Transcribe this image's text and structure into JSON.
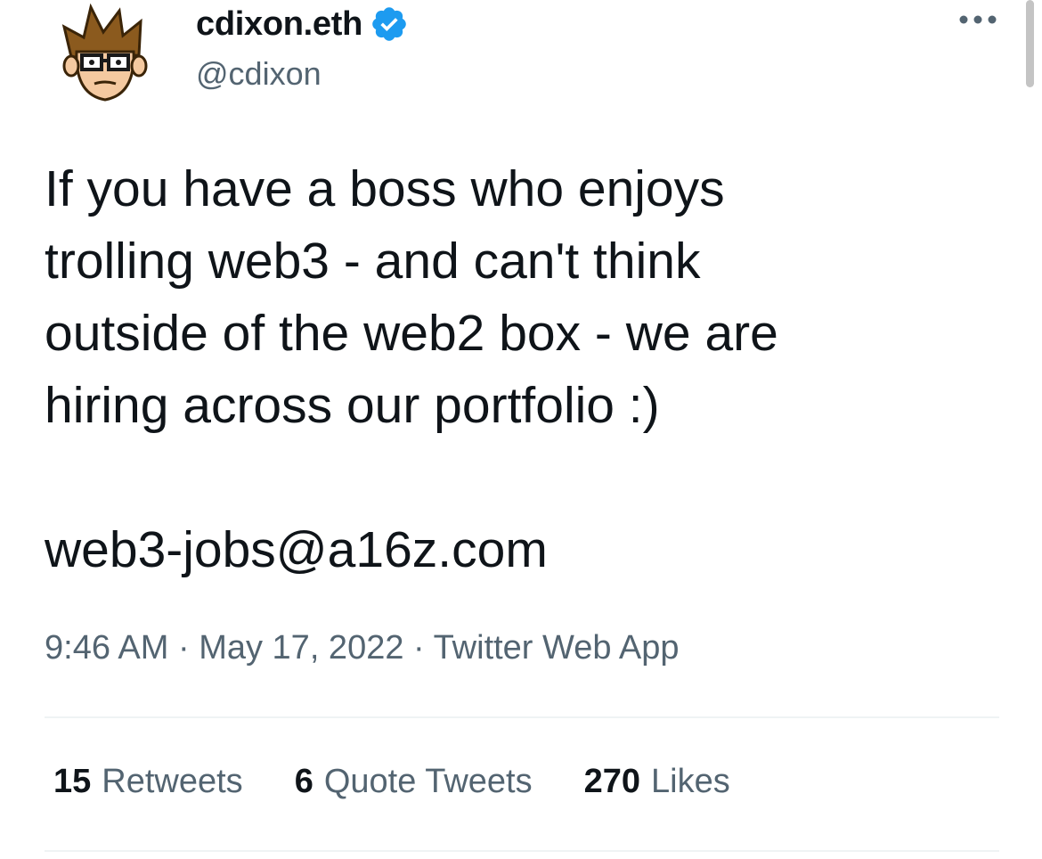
{
  "tweet": {
    "author": {
      "display_name": "cdixon.eth",
      "handle": "@cdixon",
      "verified": true,
      "avatar_icon": "cartoon-avatar-with-glasses"
    },
    "text_lines": [
      "If you have a boss who enjoys",
      "trolling web3 - and can't think",
      "outside of the web2 box - we are",
      "hiring across our portfolio :)"
    ],
    "email": "web3-jobs@a16z.com",
    "time": "9:46 AM",
    "date": "May 17, 2022",
    "separator": "·",
    "source": "Twitter Web App",
    "stats": {
      "retweets_count": "15",
      "retweets_label": "Retweets",
      "quotes_count": "6",
      "quotes_label": "Quote Tweets",
      "likes_count": "270",
      "likes_label": "Likes"
    }
  },
  "colors": {
    "text_primary": "#0f1419",
    "text_secondary": "#536471",
    "verified_blue": "#1d9bf0",
    "divider": "#eff3f4"
  },
  "icons": {
    "verified": "verified-badge-icon",
    "more": "more-horizontal-icon"
  }
}
